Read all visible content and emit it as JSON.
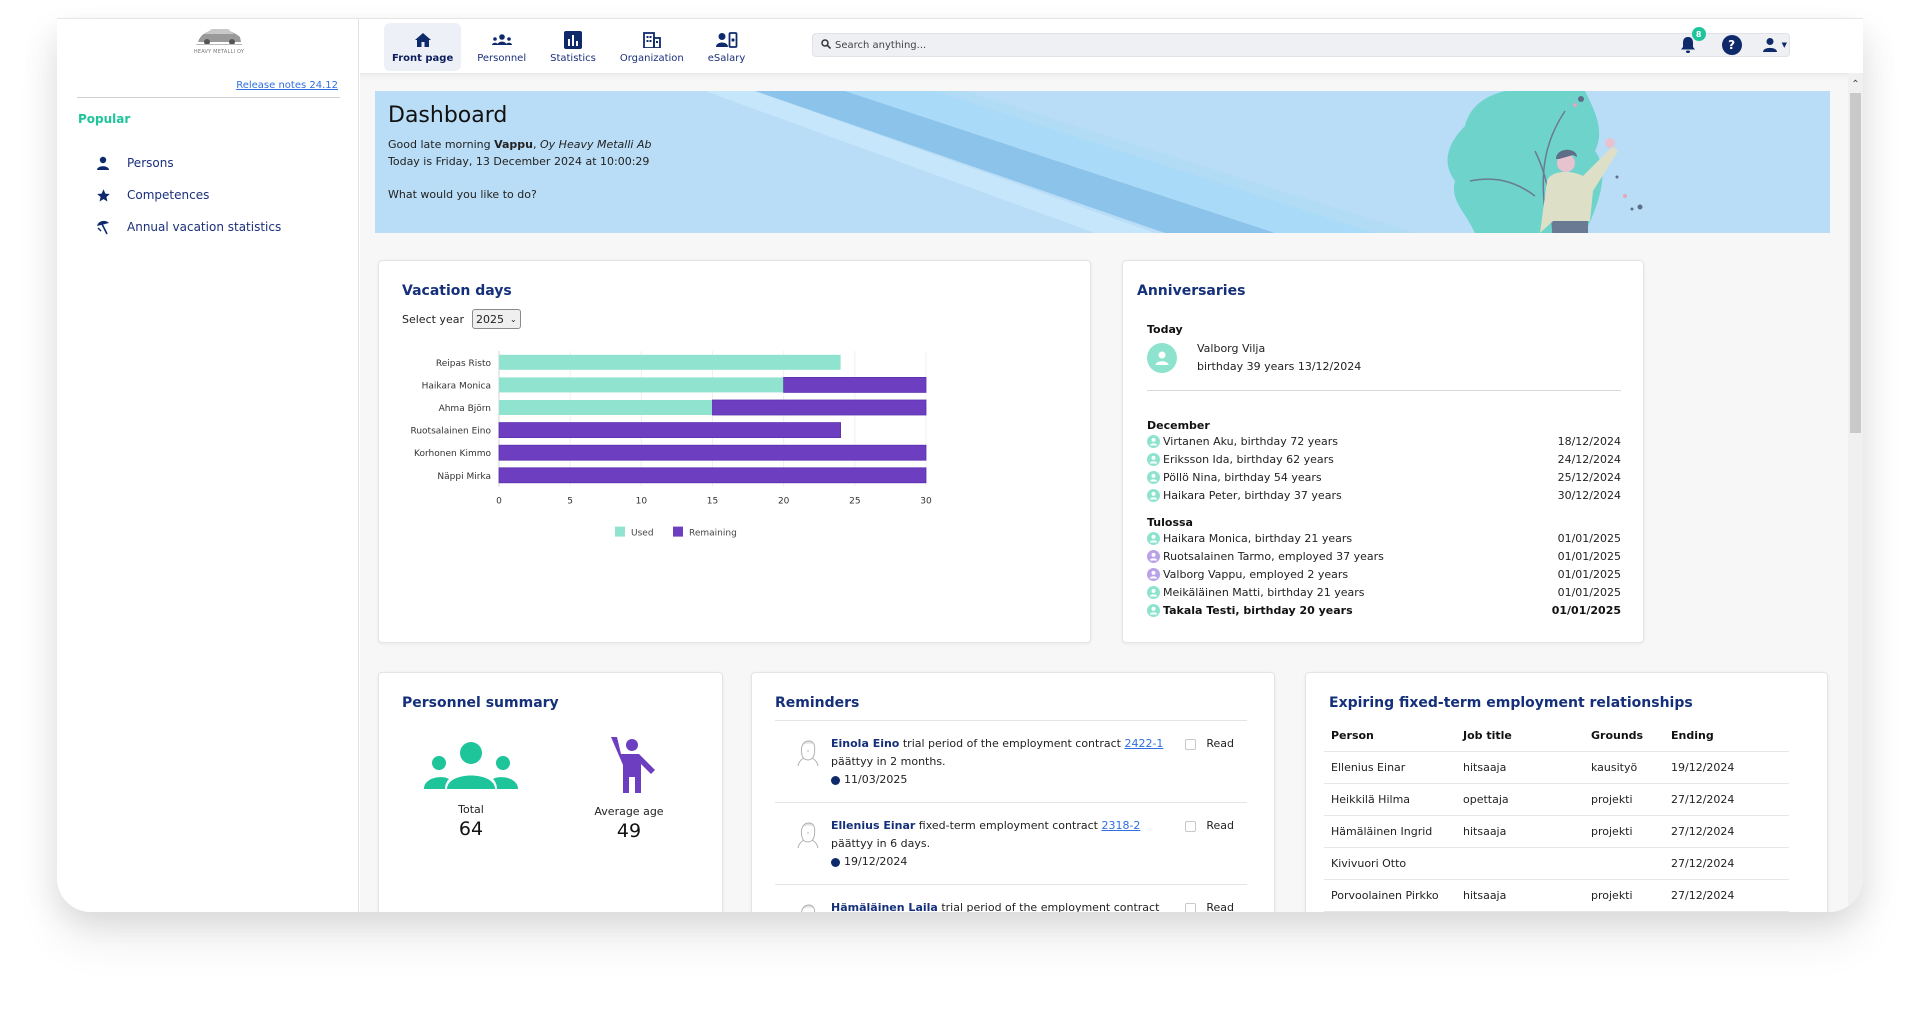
{
  "sidebar": {
    "logo_text": "HEAVY METALLI OY",
    "release_notes": "Release notes 24.12",
    "section_title": "Popular",
    "items": [
      {
        "label": "Persons",
        "icon": "person-icon"
      },
      {
        "label": "Competences",
        "icon": "star-icon"
      },
      {
        "label": "Annual vacation statistics",
        "icon": "beach-umbrella-icon"
      }
    ]
  },
  "nav": {
    "items": [
      {
        "label": "Front page",
        "icon": "home-icon",
        "active": true
      },
      {
        "label": "Personnel",
        "icon": "people-icon",
        "active": false
      },
      {
        "label": "Statistics",
        "icon": "bar-chart-icon",
        "active": false
      },
      {
        "label": "Organization",
        "icon": "building-icon",
        "active": false
      },
      {
        "label": "eSalary",
        "icon": "user-card-icon",
        "active": false
      }
    ],
    "search_placeholder": "Search anything...",
    "notification_count": "8",
    "help_label": "?"
  },
  "banner": {
    "title": "Dashboard",
    "greeting_prefix": "Good late morning ",
    "user_name": "Vappu",
    "greeting_sep": ", ",
    "company": "Oy Heavy Metalli Ab",
    "date_line": "Today is Friday, 13 December 2024 at 10:00:29",
    "question": "What would you like to do?"
  },
  "vacation": {
    "title": "Vacation days",
    "select_label": "Select year",
    "selected_year": "2025"
  },
  "chart_data": {
    "type": "bar",
    "orientation": "horizontal",
    "stacked": true,
    "title": "Vacation days",
    "categories": [
      "Reipas Risto",
      "Haikara Monica",
      "Ahma Björn",
      "Ruotsalainen Eino",
      "Korhonen Kimmo",
      "Näppi Mirka"
    ],
    "series": [
      {
        "name": "Used",
        "color": "#8fe3cf",
        "values": [
          24,
          20,
          15,
          0,
          0,
          0
        ]
      },
      {
        "name": "Remaining",
        "color": "#6d3fc0",
        "values": [
          0,
          10,
          15,
          24,
          30,
          30
        ]
      }
    ],
    "xlim": [
      0,
      30
    ],
    "xticks": [
      0,
      5,
      10,
      15,
      20,
      25,
      30
    ],
    "xlabel": "",
    "ylabel": "",
    "grid": true,
    "legend": "bottom-center"
  },
  "anniversaries": {
    "title": "Anniversaries",
    "today_heading": "Today",
    "today": {
      "name": "Valborg Vilja",
      "detail": "birthday 39 years 13/12/2024"
    },
    "groups": [
      {
        "heading": "December",
        "items": [
          {
            "text": "Virtanen Aku, birthday 72 years",
            "date": "18/12/2024",
            "type": "birthday",
            "bold": false
          },
          {
            "text": "Eriksson Ida, birthday 62 years",
            "date": "24/12/2024",
            "type": "birthday",
            "bold": false
          },
          {
            "text": "Pöllö Nina, birthday 54 years",
            "date": "25/12/2024",
            "type": "birthday",
            "bold": false
          },
          {
            "text": "Haikara Peter, birthday 37 years",
            "date": "30/12/2024",
            "type": "birthday",
            "bold": false
          }
        ]
      },
      {
        "heading": "Tulossa",
        "items": [
          {
            "text": "Haikara Monica, birthday 21 years",
            "date": "01/01/2025",
            "type": "birthday",
            "bold": false
          },
          {
            "text": "Ruotsalainen Tarmo, employed 37 years",
            "date": "01/01/2025",
            "type": "employment",
            "bold": false
          },
          {
            "text": "Valborg Vappu, employed 2 years",
            "date": "01/01/2025",
            "type": "employment",
            "bold": false
          },
          {
            "text": "Meikäläinen Matti, birthday 21 years",
            "date": "01/01/2025",
            "type": "birthday",
            "bold": false
          },
          {
            "text": "Takala Testi, birthday 20 years",
            "date": "01/01/2025",
            "type": "birthday",
            "bold": true
          }
        ]
      }
    ],
    "colors": {
      "birthday": "#8ee3cf",
      "employment": "#b9a2e8"
    }
  },
  "personnel_summary": {
    "title": "Personnel summary",
    "total_label": "Total",
    "total_value": "64",
    "avg_age_label": "Average age",
    "avg_age_value": "49"
  },
  "reminders": {
    "title": "Reminders",
    "read_label": "Read",
    "items": [
      {
        "name": "Einola Eino",
        "text": " trial period of the employment contract ",
        "link": "2422-1",
        "line2": "päättyy in 2 months.",
        "date": "11/03/2025"
      },
      {
        "name": "Ellenius Einar",
        "text": " fixed-term employment contract ",
        "link": "2318-2",
        "line2": "päättyy in 6 days.",
        "date": "19/12/2024"
      },
      {
        "name": "Hämäläinen Laila",
        "text": " trial period of the employment contract",
        "link": "",
        "line2": "",
        "date": ""
      }
    ]
  },
  "expiring": {
    "title": "Expiring fixed-term employment relationships",
    "columns": [
      "Person",
      "Job title",
      "Grounds",
      "Ending"
    ],
    "rows": [
      [
        "Ellenius Einar",
        "hitsaaja",
        "kausityö",
        "19/12/2024"
      ],
      [
        "Heikkilä Hilma",
        "opettaja",
        "projekti",
        "27/12/2024"
      ],
      [
        "Hämäläinen Ingrid",
        "hitsaaja",
        "projekti",
        "27/12/2024"
      ],
      [
        "Kivivuori Otto",
        "",
        "",
        "27/12/2024"
      ],
      [
        "Porvoolainen Pirkko",
        "hitsaaja",
        "projekti",
        "27/12/2024"
      ]
    ]
  }
}
